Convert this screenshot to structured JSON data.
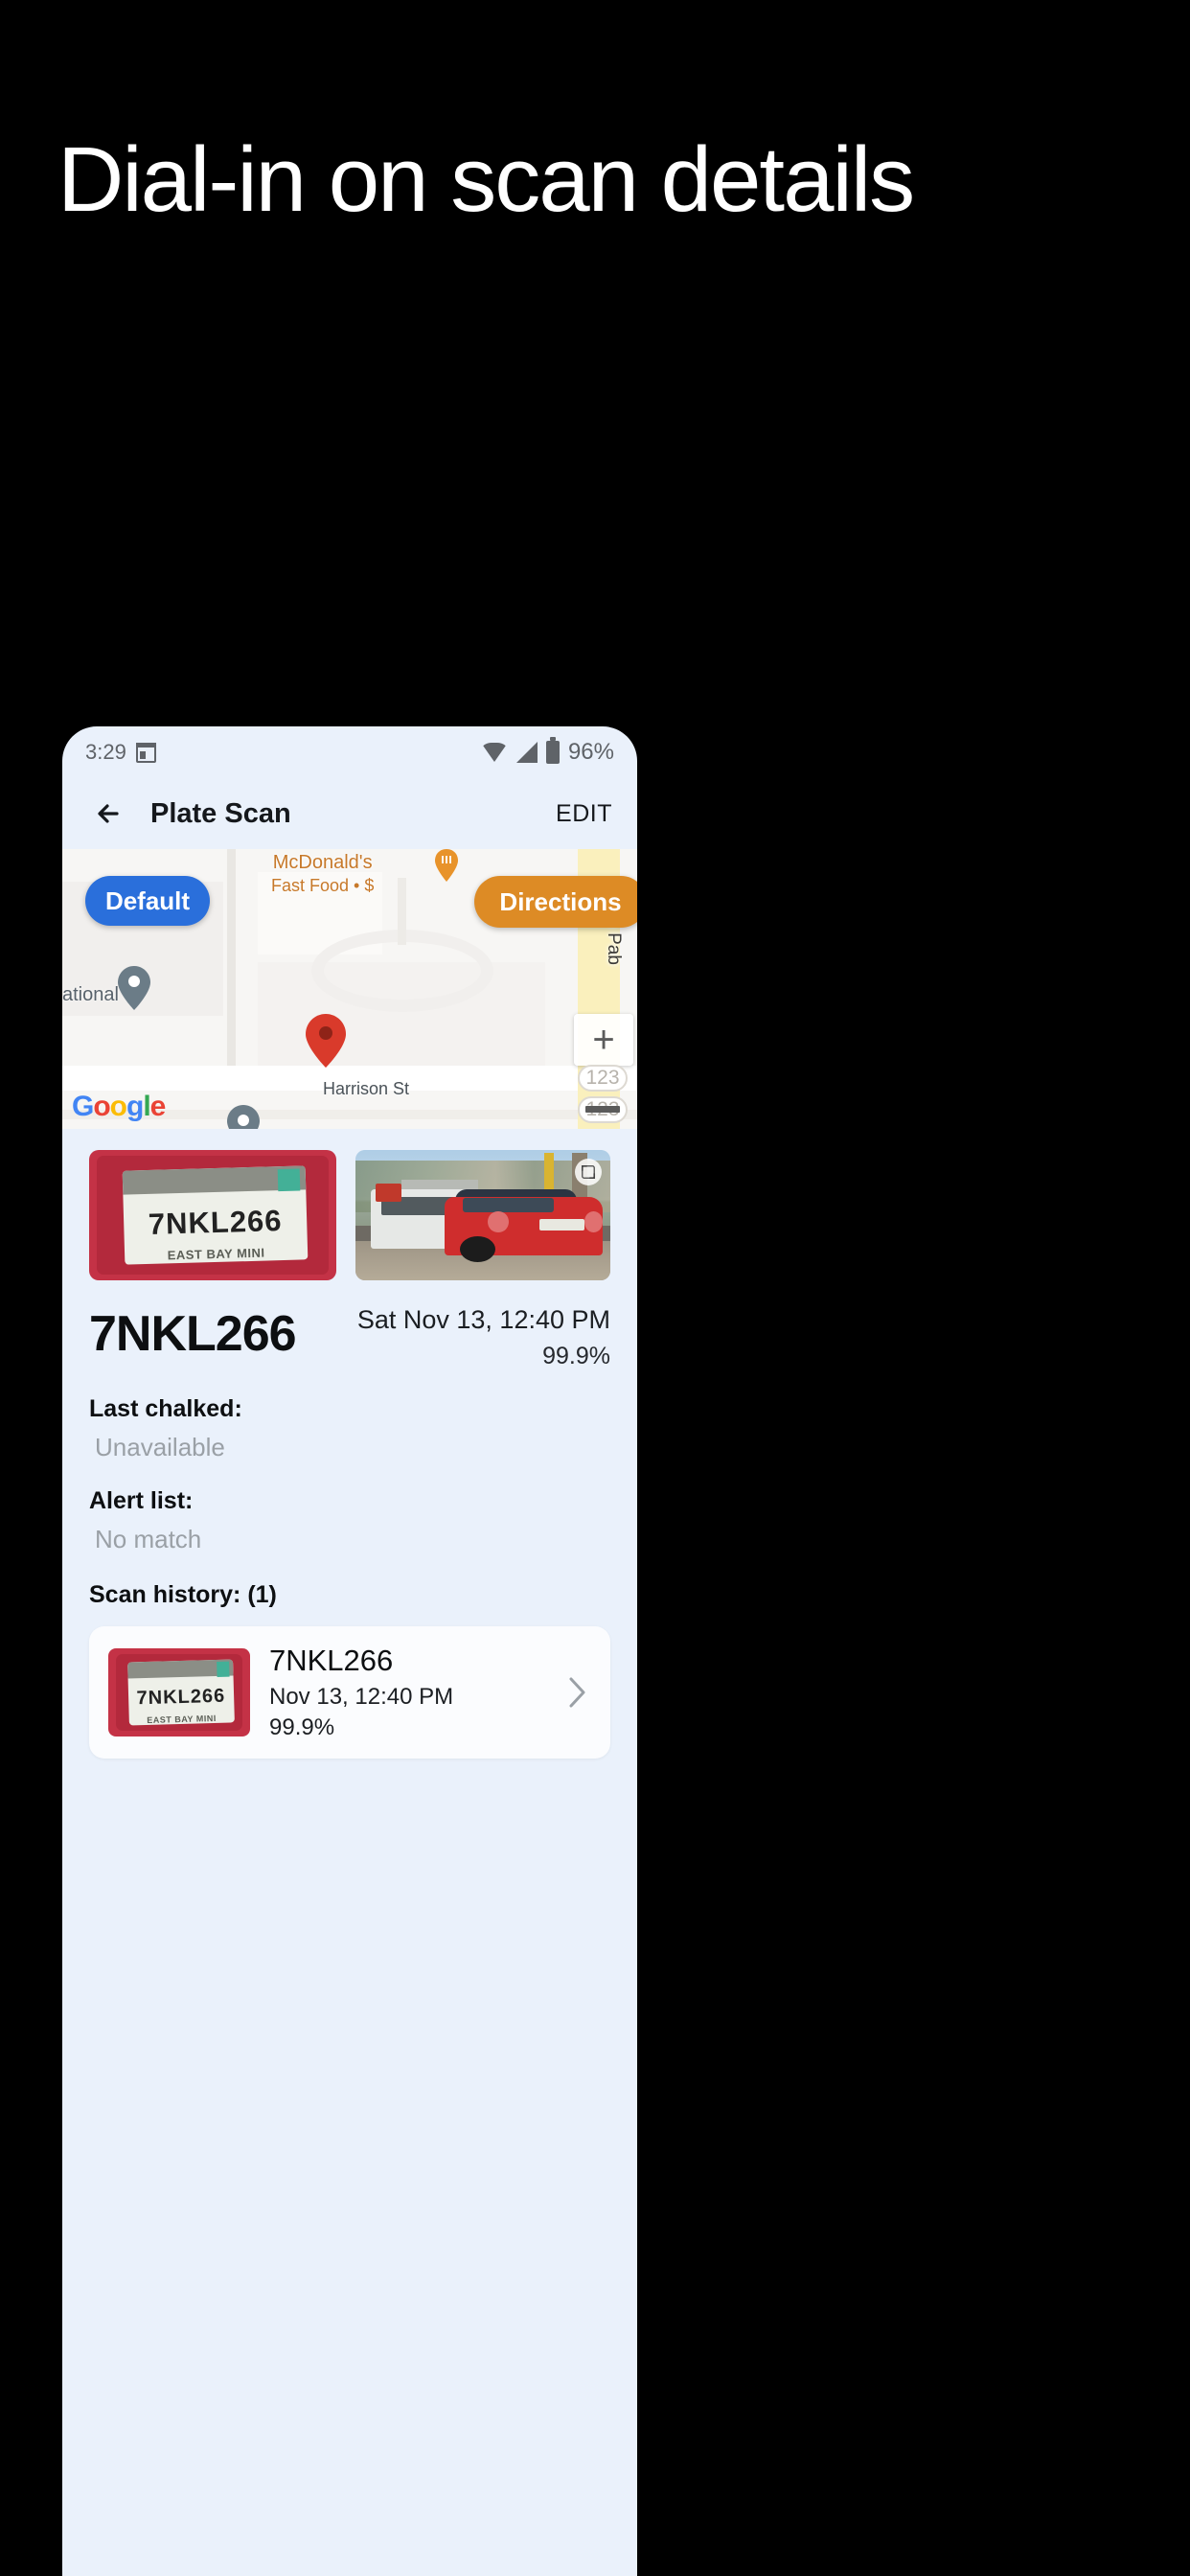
{
  "headline": "Dial-in on scan details",
  "statusbar": {
    "time": "3:29",
    "calendar_icon": "calendar-icon",
    "wifi_icon": "wifi-icon",
    "signal_icon": "signal-icon",
    "battery_icon": "battery-icon",
    "battery_percent": "96%"
  },
  "appbar": {
    "back_icon": "back-arrow-icon",
    "title": "Plate Scan",
    "edit_label": "EDIT"
  },
  "map": {
    "default_button": "Default",
    "directions_button": "Directions",
    "poi_name": "McDonald's",
    "poi_sub": "Fast Food • $",
    "label_national": "ational",
    "label_street": "Harrison St",
    "label_sanpab": "San Pab",
    "zoom_in": "+",
    "zoom_out": "−",
    "shield_1": "123",
    "shield_2": "123",
    "attribution": "Google",
    "attribution_letters": [
      "G",
      "o",
      "o",
      "g",
      "l",
      "e"
    ],
    "colors": {
      "default_button": "#2a6fdb",
      "directions_button": "#dd8b25",
      "marker_primary": "#d93a2b",
      "marker_secondary": "#6b7c87",
      "poi_text": "#c7792a"
    }
  },
  "scan": {
    "plate_photo_alt": "license-plate-photo",
    "plate_text_on_image": "7NKL266",
    "plate_frame_text": "EAST BAY MINI",
    "vehicle_photo_alt": "vehicle-photo",
    "expand_icon": "expand-icon",
    "plate_number": "7NKL266",
    "timestamp": "Sat Nov 13, 12:40 PM",
    "confidence": "99.9%"
  },
  "details": [
    {
      "label": "Last chalked:",
      "value": "Unavailable"
    },
    {
      "label": "Alert list:",
      "value": "No match"
    }
  ],
  "history": {
    "heading": "Scan history: (1)",
    "items": [
      {
        "thumb_plate_text": "7NKL266",
        "thumb_frame_text": "EAST BAY MINI",
        "plate": "7NKL266",
        "date": "Nov 13, 12:40 PM",
        "confidence": "99.9%",
        "chevron_icon": "chevron-right-icon"
      }
    ]
  }
}
